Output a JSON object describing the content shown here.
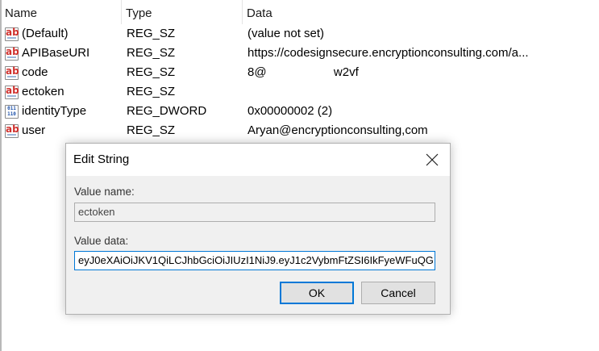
{
  "columns": {
    "name": "Name",
    "type": "Type",
    "data": "Data"
  },
  "rows": [
    {
      "icon": "string-value-icon",
      "name": "(Default)",
      "type": "REG_SZ",
      "data": "(value not set)"
    },
    {
      "icon": "string-value-icon",
      "name": "APIBaseURI",
      "type": "REG_SZ",
      "data": "https://codesignsecure.encryptionconsulting.com/a..."
    },
    {
      "icon": "string-value-icon",
      "name": "code",
      "type": "REG_SZ",
      "data": "8@                    w2vf"
    },
    {
      "icon": "string-value-icon",
      "name": "ectoken",
      "type": "REG_SZ",
      "data": ""
    },
    {
      "icon": "dword-value-icon",
      "name": "identityType",
      "type": "REG_DWORD",
      "data": "0x00000002 (2)"
    },
    {
      "icon": "string-value-icon",
      "name": "user",
      "type": "REG_SZ",
      "data": "Aryan@encryptionconsulting,com"
    }
  ],
  "dialog": {
    "title": "Edit String",
    "value_name_label": "Value name:",
    "value_name": "ectoken",
    "value_data_label": "Value data:",
    "value_data": "eyJ0eXAiOiJKV1QiLCJhbGciOiJIUzI1NiJ9.eyJ1c2VybmFtZSI6IkFyeWFuQG",
    "ok_label": "OK",
    "cancel_label": "Cancel"
  },
  "colors": {
    "accent": "#0078d7",
    "string_icon": "#d0312d",
    "dword_icon": "#1b4fa8"
  }
}
